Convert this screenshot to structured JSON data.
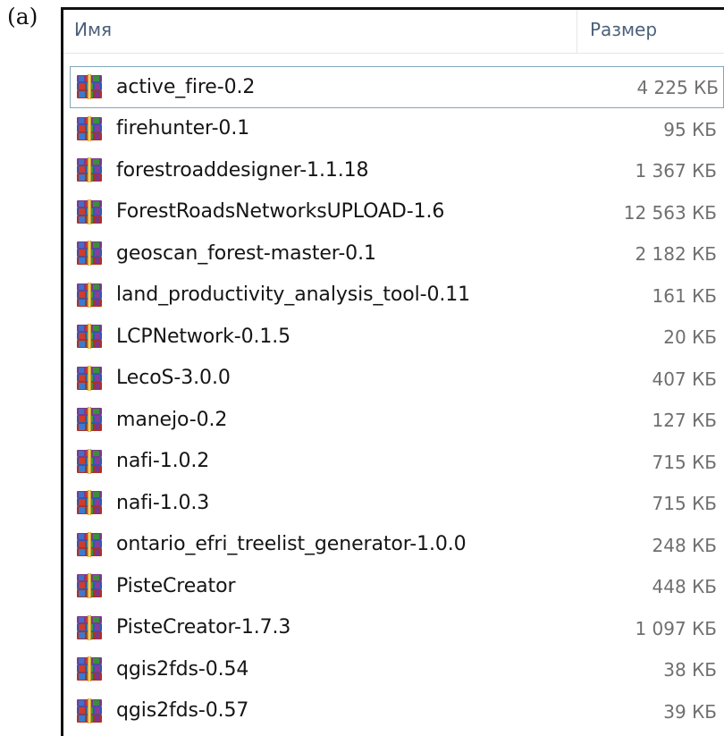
{
  "panel_label": "(a)",
  "header": {
    "name_label": "Имя",
    "size_label": "Размер"
  },
  "files": [
    {
      "name": "active_fire-0.2",
      "size": "4 225 КБ",
      "selected": true
    },
    {
      "name": "firehunter-0.1",
      "size": "95 КБ"
    },
    {
      "name": "forestroaddesigner-1.1.18",
      "size": "1 367 КБ"
    },
    {
      "name": "ForestRoadsNetworksUPLOAD-1.6",
      "size": "12 563 КБ"
    },
    {
      "name": "geoscan_forest-master-0.1",
      "size": "2 182 КБ"
    },
    {
      "name": "land_productivity_analysis_tool-0.11",
      "size": "161 КБ"
    },
    {
      "name": "LCPNetwork-0.1.5",
      "size": "20 КБ"
    },
    {
      "name": "LecoS-3.0.0",
      "size": "407 КБ"
    },
    {
      "name": "manejo-0.2",
      "size": "127 КБ"
    },
    {
      "name": "nafi-1.0.2",
      "size": "715 КБ"
    },
    {
      "name": "nafi-1.0.3",
      "size": "715 КБ"
    },
    {
      "name": "ontario_efri_treelist_generator-1.0.0",
      "size": "248 КБ"
    },
    {
      "name": "PisteCreator",
      "size": "448 КБ"
    },
    {
      "name": "PisteCreator-1.7.3",
      "size": "1 097 КБ"
    },
    {
      "name": "qgis2fds-0.54",
      "size": "38 КБ"
    },
    {
      "name": "qgis2fds-0.57",
      "size": "39 КБ"
    }
  ],
  "icon": "winrar-archive-icon"
}
